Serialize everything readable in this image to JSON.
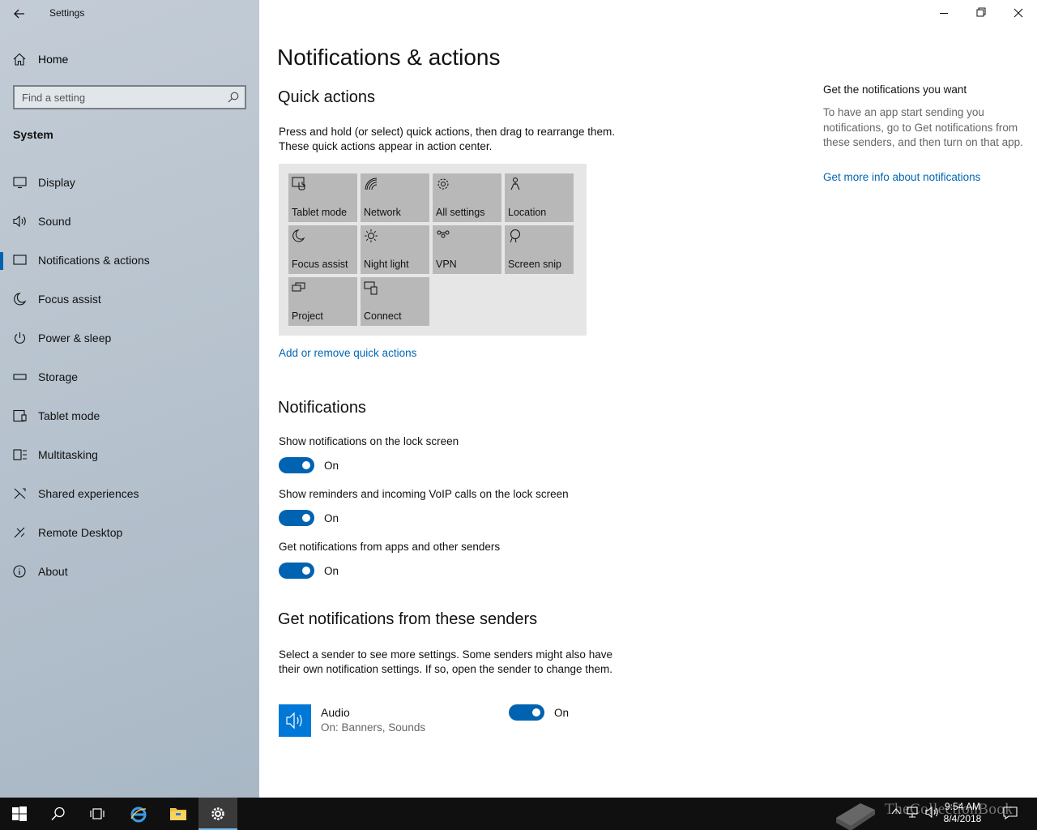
{
  "window": {
    "title": "Settings",
    "minimize_label": "Minimize",
    "restore_label": "Restore",
    "close_label": "Close"
  },
  "sidebar": {
    "home_label": "Home",
    "search_placeholder": "Find a setting",
    "section": "System",
    "items": [
      {
        "label": "Display",
        "icon": "display-icon"
      },
      {
        "label": "Sound",
        "icon": "speaker-icon"
      },
      {
        "label": "Notifications & actions",
        "icon": "notification-icon",
        "active": true
      },
      {
        "label": "Focus assist",
        "icon": "moon-icon"
      },
      {
        "label": "Power & sleep",
        "icon": "power-icon"
      },
      {
        "label": "Storage",
        "icon": "storage-icon"
      },
      {
        "label": "Tablet mode",
        "icon": "tablet-icon"
      },
      {
        "label": "Multitasking",
        "icon": "multitasking-icon"
      },
      {
        "label": "Shared experiences",
        "icon": "shared-icon"
      },
      {
        "label": "Remote Desktop",
        "icon": "remote-icon"
      },
      {
        "label": "About",
        "icon": "info-icon"
      }
    ]
  },
  "main": {
    "title": "Notifications & actions",
    "quick_actions": {
      "heading": "Quick actions",
      "description_line1": "Press and hold (or select) quick actions, then drag to rearrange them.",
      "description_line2": "These quick actions appear in action center.",
      "tiles": [
        {
          "label": "Tablet mode",
          "icon": "tablet-mode-icon"
        },
        {
          "label": "Network",
          "icon": "network-icon"
        },
        {
          "label": "All settings",
          "icon": "gear-icon"
        },
        {
          "label": "Location",
          "icon": "location-icon"
        },
        {
          "label": "Focus assist",
          "icon": "moon-icon"
        },
        {
          "label": "Night light",
          "icon": "brightness-icon"
        },
        {
          "label": "VPN",
          "icon": "vpn-icon"
        },
        {
          "label": "Screen snip",
          "icon": "screen-snip-icon"
        },
        {
          "label": "Project",
          "icon": "project-icon"
        },
        {
          "label": "Connect",
          "icon": "connect-icon"
        }
      ],
      "link": "Add or remove quick actions"
    },
    "notifications": {
      "heading": "Notifications",
      "settings": [
        {
          "label": "Show notifications on the lock screen",
          "state": "On"
        },
        {
          "label": "Show reminders and incoming VoIP calls on the lock screen",
          "state": "On"
        },
        {
          "label": "Get notifications from apps and other senders",
          "state": "On"
        }
      ]
    },
    "senders": {
      "heading": "Get notifications from these senders",
      "description_line1": "Select a sender to see more settings. Some senders might also have",
      "description_line2": "their own notification settings. If so, open the sender to change them.",
      "items": [
        {
          "name": "Audio",
          "detail": "On: Banners, Sounds",
          "state": "On",
          "icon": "speaker-icon"
        }
      ]
    }
  },
  "side_panel": {
    "title": "Get the notifications you want",
    "text": "To have an app start sending you notifications, go to Get notifications from these senders, and then turn on that app.",
    "link": "Get more info about notifications"
  },
  "taskbar": {
    "time": "9:54 AM",
    "date": "8/4/2018",
    "watermark": "TheCollectionBook",
    "accent": "#0078d7"
  }
}
